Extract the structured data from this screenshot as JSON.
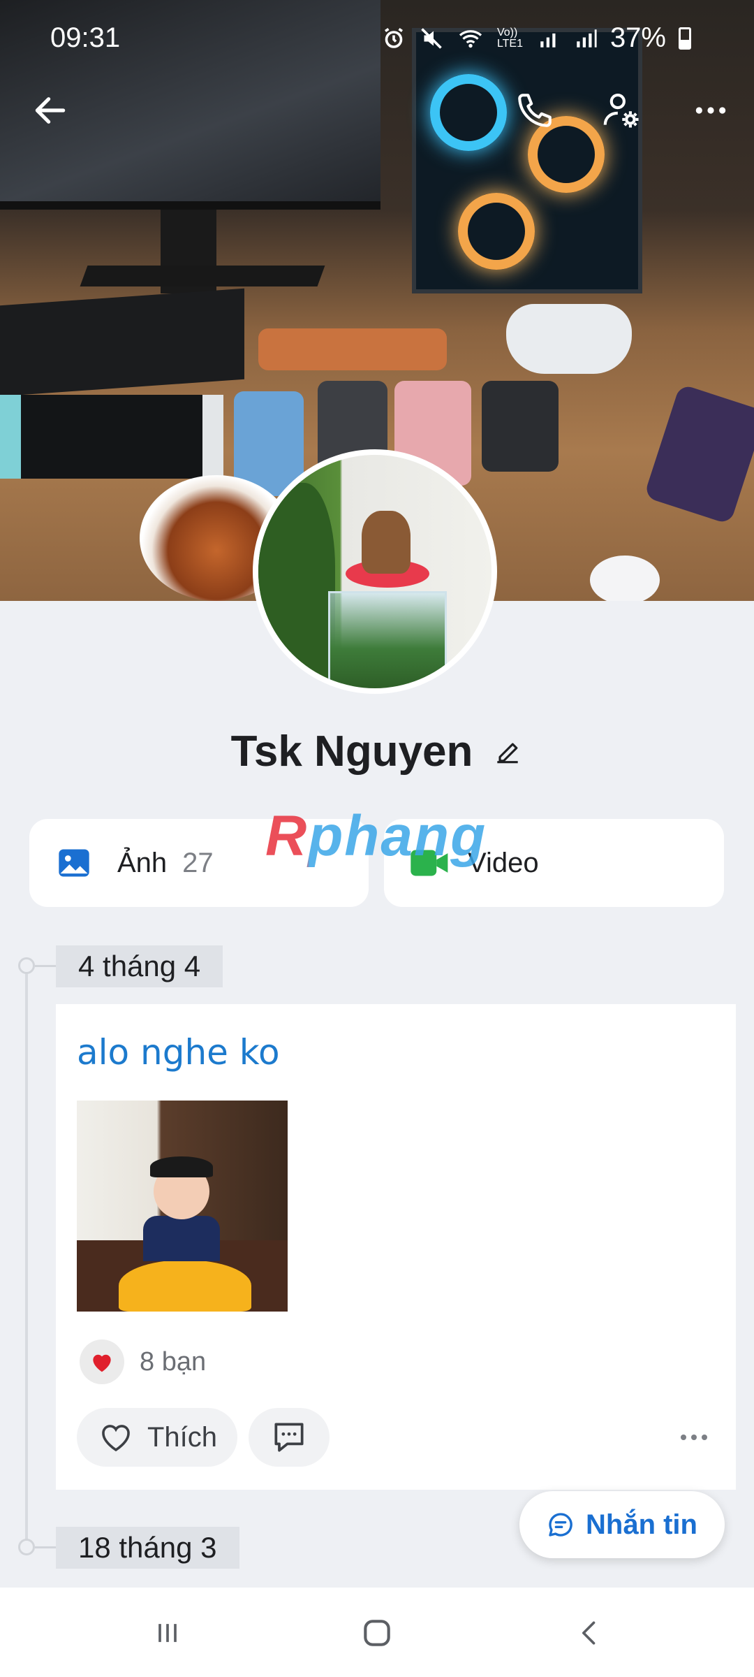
{
  "status_bar": {
    "time": "09:31",
    "battery": "37%",
    "network": "Vo)) LTE1"
  },
  "top_nav": {
    "back_icon": "arrow-left-icon",
    "call_icon": "phone-icon",
    "settings_icon": "user-gear-icon",
    "more_icon": "more-horizontal-icon"
  },
  "profile": {
    "name": "Tsk Nguyen",
    "edit_icon": "pencil-icon"
  },
  "media": {
    "photos_label": "Ảnh",
    "photos_count": "27",
    "videos_label": "Video"
  },
  "watermark": "Rphang",
  "timeline": {
    "first_date": "4 tháng 4",
    "second_date": "18 tháng 3"
  },
  "post": {
    "text": "alo nghe ko",
    "reaction_count": "8 bạn",
    "like_label": "Thích",
    "colors": {
      "text": "#1c7acd",
      "heart": "#e0202c"
    }
  },
  "message_button": {
    "label": "Nhắn tin",
    "color": "#1a6fd1"
  },
  "system_nav": {
    "recents_icon": "recents-icon",
    "home_icon": "home-icon",
    "back_icon": "back-chevron-icon"
  }
}
